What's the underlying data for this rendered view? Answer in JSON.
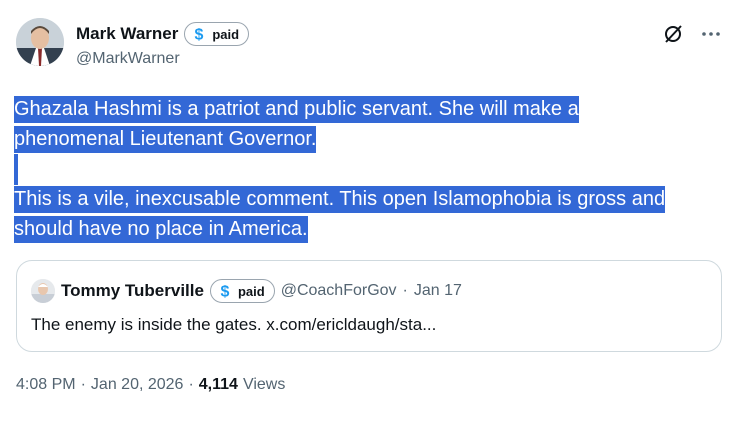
{
  "author": {
    "display_name": "Mark Warner",
    "handle": "@MarkWarner",
    "badge_label": "paid"
  },
  "tweet": {
    "lines": [
      "Ghazala Hashmi is a patriot and public servant. She will make a",
      "phenomenal Lieutenant Governor.",
      "",
      "This is a vile, inexcusable comment. This open Islamophobia is gross and",
      "should have no place in America."
    ]
  },
  "quoted": {
    "display_name": "Tommy Tuberville",
    "badge_label": "paid",
    "handle": "@CoachForGov",
    "separator": "·",
    "date": "Jan 17",
    "text": "The enemy is inside the gates. x.com/ericldaugh/sta..."
  },
  "meta": {
    "time": "4:08 PM",
    "sep1": "·",
    "date": "Jan 20, 2026",
    "sep2": "·",
    "views_count": "4,114",
    "views_label": "Views"
  },
  "icons": {
    "grok": "slashed-circle-icon",
    "more": "more-horizontal-icon",
    "badge": "dollar-badge-icon"
  },
  "colors": {
    "selection": "#3368d6",
    "badge_blue": "#1d9bf0",
    "muted": "#536471"
  }
}
